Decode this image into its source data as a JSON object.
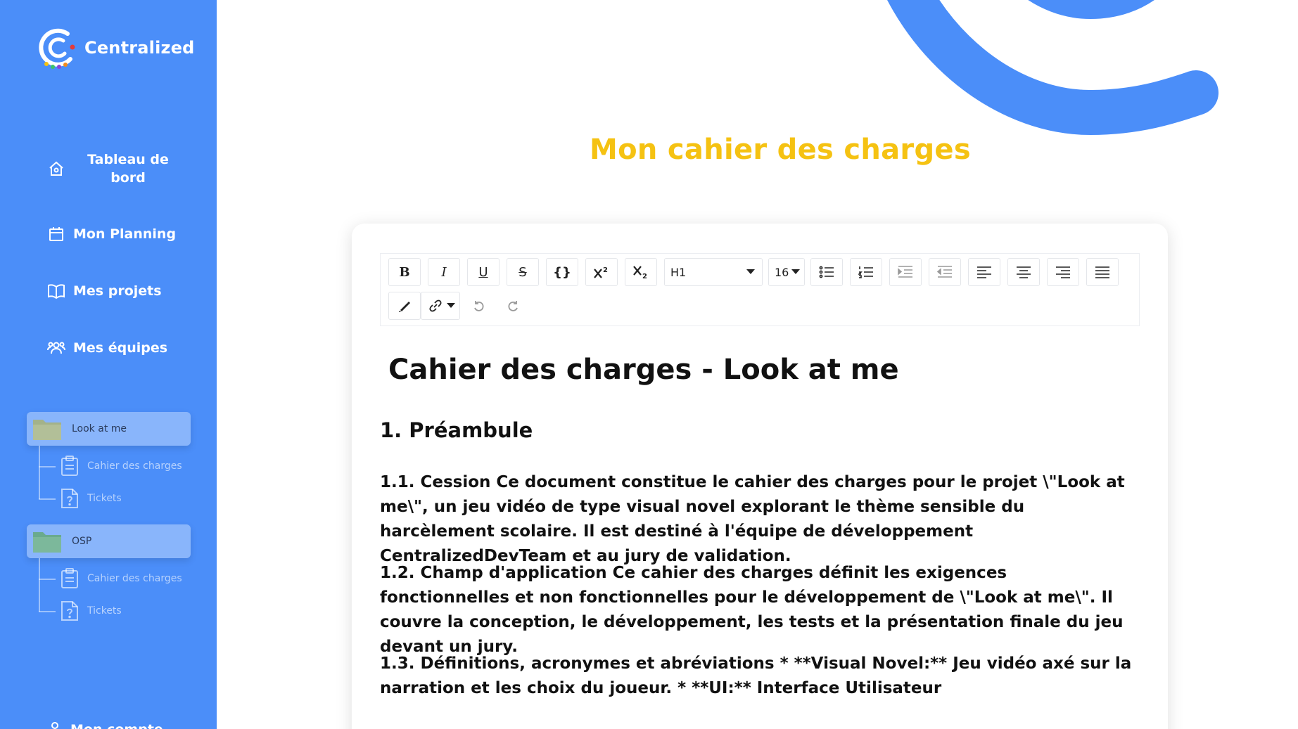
{
  "app": {
    "logo_text": "Centralized"
  },
  "nav": {
    "items": [
      {
        "label": "Tableau de bord",
        "icon": "home-icon"
      },
      {
        "label": "Mon Planning",
        "icon": "calendar-icon"
      },
      {
        "label": "Mes projets",
        "icon": "book-icon"
      },
      {
        "label": "Mes équipes",
        "icon": "team-icon"
      }
    ],
    "account_label": "Mon compte"
  },
  "projects": [
    {
      "name": "Look at me",
      "folder_color": "#a3b28a",
      "children": [
        {
          "label": "Cahier des charges",
          "icon": "clipboard-icon"
        },
        {
          "label": "Tickets",
          "icon": "ticket-file-icon"
        }
      ]
    },
    {
      "name": "OSP",
      "folder_color": "#6aaa8e",
      "children": [
        {
          "label": "Cahier des charges",
          "icon": "clipboard-icon"
        },
        {
          "label": "Tickets",
          "icon": "ticket-file-icon"
        }
      ]
    }
  ],
  "page": {
    "title": "Mon cahier des charges"
  },
  "toolbar": {
    "bold": "B",
    "italic": "I",
    "underline": "U",
    "strike": "S",
    "code": "{}",
    "heading_value": "H1",
    "font_size_value": "16"
  },
  "document": {
    "title": "Cahier des charges - Look at me",
    "section": "1. Préambule",
    "paragraphs": [
      "1.1. Cession Ce document constitue le cahier des charges pour le projet \\\"Look at me\\\", un jeu vidéo de type visual novel explorant le thème sensible du harcèlement scolaire. Il est destiné à l'équipe de développement CentralizedDevTeam et au jury de validation.",
      "1.2. Champ d'application Ce cahier des charges définit les exigences fonctionnelles et non fonctionnelles pour le développement de \\\"Look at me\\\". Il couvre la conception, le développement, les tests et la présentation finale du jeu devant un jury.",
      "1.3. Définitions, acronymes et abréviations * **Visual Novel:** Jeu vidéo axé sur la narration et les choix du joueur. * **UI:** Interface Utilisateur"
    ]
  },
  "colors": {
    "sidebar": "#4b8ef9",
    "accent_title": "#f5c212",
    "ring": "#4b8ef9"
  }
}
